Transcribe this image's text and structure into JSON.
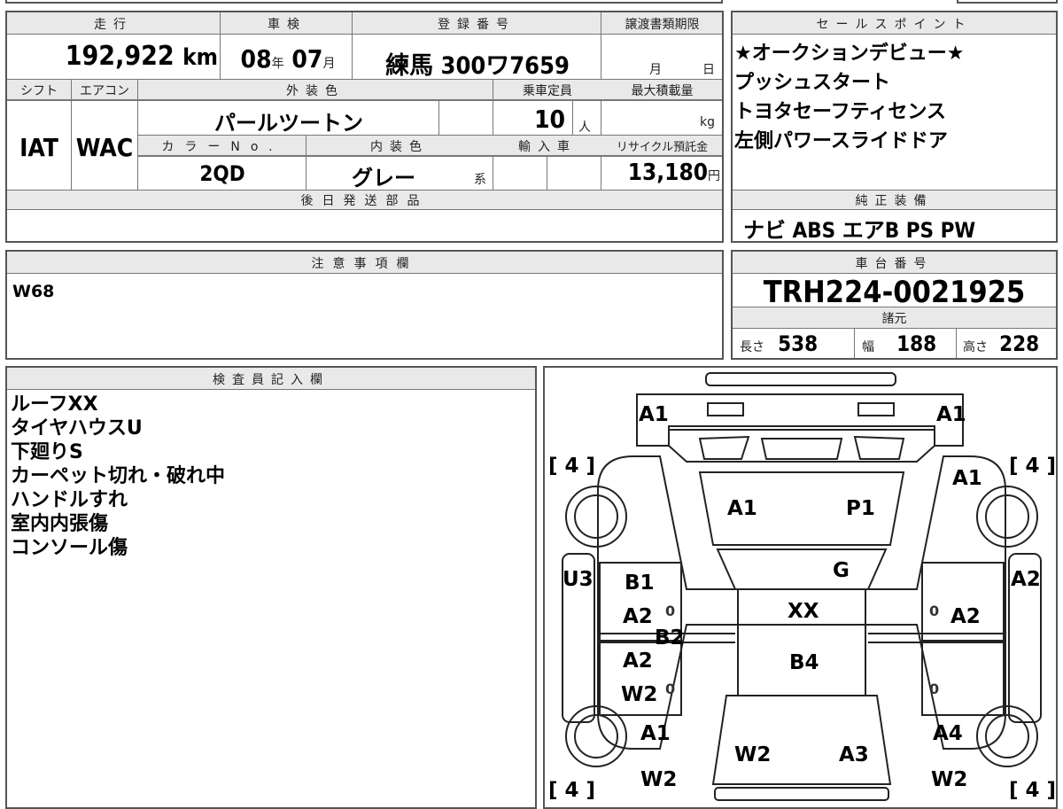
{
  "top": {
    "headers": {
      "mileage": "走行",
      "inspection": "車検",
      "registration": "登録番号",
      "transfer_deadline": "譲渡書類期限"
    },
    "mileage": "192,922",
    "mileage_unit": "km",
    "inspection_year": "08",
    "year_unit": "年",
    "inspection_month": "07",
    "month_unit": "月",
    "registration_number": "練馬 300ワ7659",
    "deadline_month_unit": "月",
    "deadline_day_unit": "日"
  },
  "row2": {
    "headers": {
      "shift": "シフト",
      "aircon": "エアコン",
      "exterior_color": "外装色",
      "capacity": "乗車定員",
      "max_load": "最大積載量"
    },
    "shift": "IAT",
    "aircon": "WAC",
    "exterior_color": "パールツートン",
    "capacity": "10",
    "capacity_unit": "人",
    "max_load_unit": "kg"
  },
  "row3": {
    "headers": {
      "color_no": "カラーNo.",
      "interior_color": "内装色",
      "import": "輸入車",
      "recycle": "リサイクル預託金"
    },
    "color_no": "2QD",
    "interior_color": "グレー",
    "interior_suffix": "系",
    "recycle_fee": "13,180",
    "yen_unit": "円"
  },
  "later_parts": {
    "header": "後日発送部品"
  },
  "sales_points": {
    "header": "セールスポイント",
    "items": [
      "★オークションデビュー★",
      "プッシュスタート",
      "トヨタセーフティセンス",
      "左側パワースライドドア"
    ]
  },
  "equipment": {
    "header": "純正装備",
    "value": "ナビ ABS エアB PS PW"
  },
  "caution": {
    "header": "注意事項欄",
    "text": "W68"
  },
  "chassis": {
    "header": "車台番号",
    "number": "TRH224-0021925"
  },
  "specs": {
    "header": "諸元",
    "length_label": "長さ",
    "length": "538",
    "width_label": "幅",
    "width": "188",
    "height_label": "高さ",
    "height": "228"
  },
  "inspector": {
    "header": "検査員記入欄",
    "notes": [
      "ルーフXX",
      "タイヤハウスU",
      "下廻りS",
      "カーペット切れ・破れ中",
      "ハンドルすれ",
      "室内内張傷",
      "コンソール傷"
    ]
  },
  "diagram": {
    "tire_tl": "[ 4 ]",
    "tire_tr": "[ 4 ]",
    "tire_bl": "[ 4 ]",
    "tire_br": "[ 4 ]",
    "zero": "0",
    "marks": {
      "top_left": "A1",
      "top_right": "A1",
      "right_fender": "A1",
      "windshield_a": "A1",
      "windshield_b": "P1",
      "hood_g": "G",
      "left_panel": "U3",
      "right_panel": "A2",
      "l_door1": "B1",
      "l_door2": "A2",
      "l_b2": "B2",
      "l_door3": "A2",
      "l_door4": "W2",
      "roof": "XX",
      "roof2": "B4",
      "r_door": "A2",
      "l_rear": "A1",
      "r_rear": "A4",
      "rear_a": "W2",
      "rear_b": "A3",
      "bl": "W2",
      "br": "W2"
    }
  }
}
